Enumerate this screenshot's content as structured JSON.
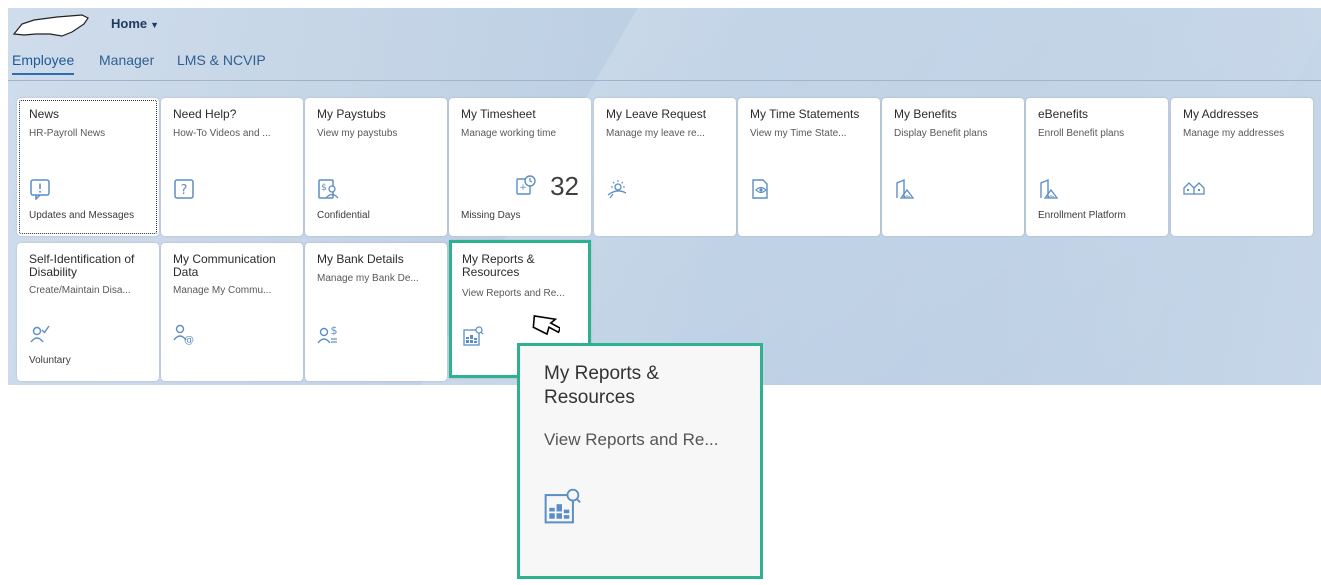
{
  "header": {
    "home_label": "Home"
  },
  "tabs": [
    {
      "label": "Employee",
      "active": true
    },
    {
      "label": "Manager",
      "active": false
    },
    {
      "label": "LMS & NCVIP",
      "active": false
    }
  ],
  "tiles": [
    {
      "title": "News",
      "subtitle": "HR-Payroll News",
      "icon": "exclamation-icon",
      "footer": "Updates and Messages"
    },
    {
      "title": "Need Help?",
      "subtitle": "How-To Videos and ...",
      "icon": "question-icon",
      "footer": ""
    },
    {
      "title": "My Paystubs",
      "subtitle": "View my paystubs",
      "icon": "paystub-icon",
      "footer": "Confidential"
    },
    {
      "title": "My Timesheet",
      "subtitle": "Manage working time",
      "icon": "timesheet-icon",
      "kpi": "32",
      "footer": "Missing Days"
    },
    {
      "title": "My Leave Request",
      "subtitle": "Manage my leave re...",
      "icon": "sun-horizon-icon",
      "footer": ""
    },
    {
      "title": "My Time Statements",
      "subtitle": "View my Time State...",
      "icon": "document-eye-icon",
      "footer": ""
    },
    {
      "title": "My Benefits",
      "subtitle": "Display Benefit plans",
      "icon": "benefits-building-icon",
      "footer": ""
    },
    {
      "title": "eBenefits",
      "subtitle": "Enroll Benefit plans",
      "icon": "benefits-building-icon",
      "footer": "Enrollment Platform"
    },
    {
      "title": "My Addresses",
      "subtitle": "Manage my addresses",
      "icon": "houses-icon",
      "footer": ""
    },
    {
      "title": "Self-Identification of Disability",
      "subtitle": "Create/Maintain Disa...",
      "icon": "person-check-icon",
      "footer": "Voluntary"
    },
    {
      "title": "My Communication Data",
      "subtitle": "Manage My Commu...",
      "icon": "person-at-icon",
      "footer": ""
    },
    {
      "title": "My Bank Details",
      "subtitle": "Manage my Bank De...",
      "icon": "person-dollar-icon",
      "footer": ""
    },
    {
      "title": "My Reports & Resources",
      "subtitle": "View Reports and Re...",
      "icon": "report-search-icon",
      "footer": ""
    }
  ],
  "popup": {
    "title": "My Reports & Resources",
    "subtitle": "View Reports and Re...",
    "icon": "report-search-icon"
  },
  "colors": {
    "accent": "#2eb18f",
    "icon": "#5b8ec4",
    "tab_active": "#2f6db5"
  }
}
